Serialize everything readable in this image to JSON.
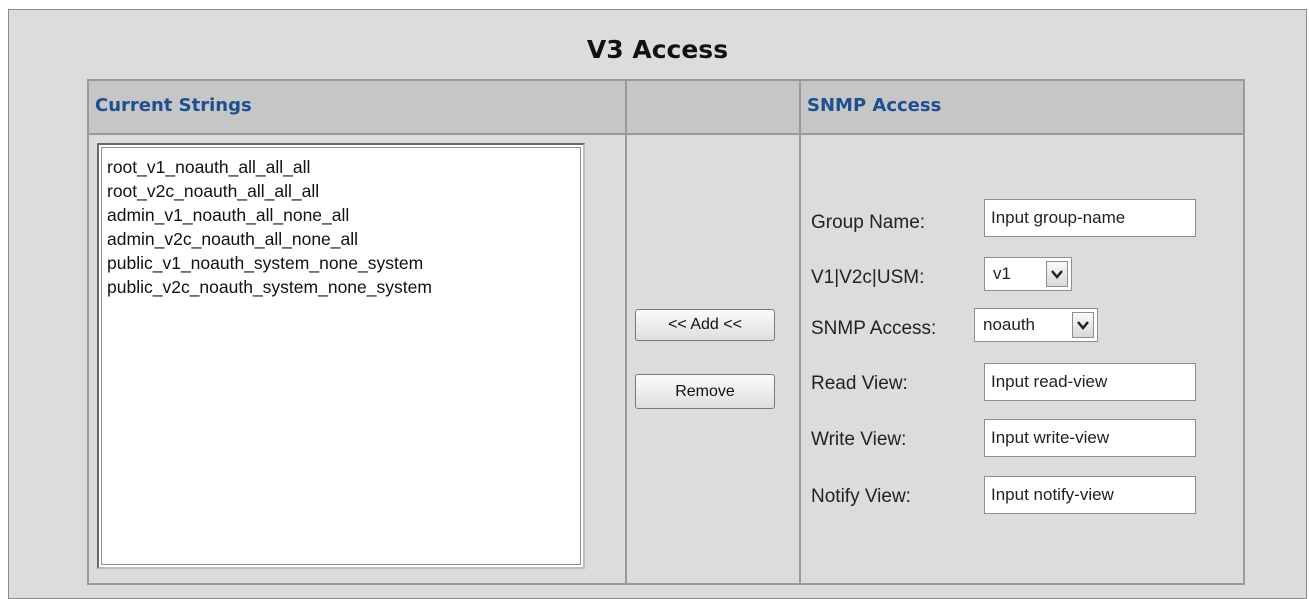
{
  "page": {
    "title": "V3 Access"
  },
  "left": {
    "header": "Current Strings",
    "items": [
      "root_v1_noauth_all_all_all",
      "root_v2c_noauth_all_all_all",
      "admin_v1_noauth_all_none_all",
      "admin_v2c_noauth_all_none_all",
      "public_v1_noauth_system_none_system",
      "public_v2c_noauth_system_none_system"
    ]
  },
  "middle": {
    "add_label": "<< Add <<",
    "remove_label": "Remove"
  },
  "right": {
    "header": "SNMP Access",
    "group_name": {
      "label": "Group Name:",
      "placeholder": "Input group-name"
    },
    "version": {
      "label": "V1|V2c|USM:",
      "value": "v1"
    },
    "snmp_access": {
      "label": "SNMP Access:",
      "value": "noauth"
    },
    "read_view": {
      "label": "Read View:",
      "placeholder": "Input read-view"
    },
    "write_view": {
      "label": "Write View:",
      "placeholder": "Input write-view"
    },
    "notify_view": {
      "label": "Notify View:",
      "placeholder": "Input notify-view"
    }
  },
  "colors": {
    "header_text": "#1e4f8f",
    "panel_bg": "#dcdcdc",
    "header_bg": "#c6c6c6"
  }
}
